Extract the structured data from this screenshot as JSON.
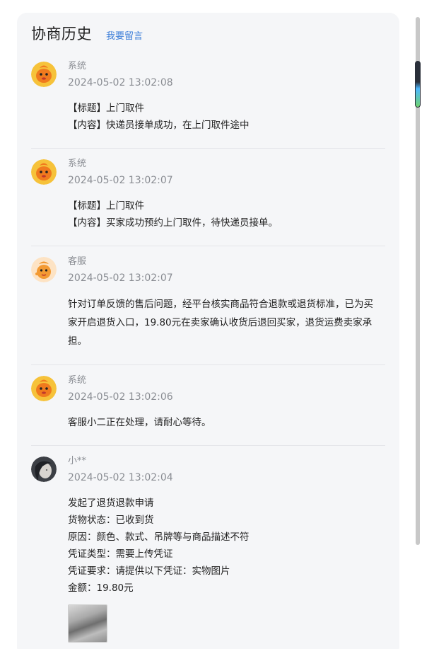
{
  "header": {
    "title": "协商历史",
    "leave_message": "我要留言"
  },
  "records": [
    {
      "author": "系统",
      "avatar": "mascot-icon",
      "time": "2024-05-02 13:02:08",
      "lines": [
        "【标题】上门取件",
        "【内容】快递员接单成功，在上门取件途中"
      ]
    },
    {
      "author": "系统",
      "avatar": "mascot-icon",
      "time": "2024-05-02 13:02:07",
      "lines": [
        "【标题】上门取件",
        "【内容】买家成功预约上门取件，待快递员接单。"
      ]
    },
    {
      "author": "客服",
      "avatar": "service-mascot-icon",
      "time": "2024-05-02 13:02:07",
      "paragraph_lines": [
        "针对订单反馈的售后问题，经平台核实商品符合退款或退货标准，已为买",
        "家开启退货入口，19.80元在卖家确认收货后退回买家，退货运费卖家承",
        "担。"
      ]
    },
    {
      "author": "系统",
      "avatar": "mascot-icon",
      "time": "2024-05-02 13:02:06",
      "lines": [
        "客服小二正在处理，请耐心等待。"
      ]
    },
    {
      "author": "小**",
      "avatar": "user-avatar",
      "time": "2024-05-02 13:02:04",
      "lines": [
        "发起了退货退款申请",
        "货物状态：已收到货",
        "原因：颜色、款式、吊牌等与商品描述不符",
        "凭证类型：需要上传凭证",
        "凭证要求：请提供以下凭证：实物图片",
        "金额：19.80元"
      ],
      "attachment": "evidence-photo"
    }
  ],
  "colors": {
    "panel_bg": "#f5f6f8",
    "link": "#3b7dd8",
    "muted": "#8a8d93",
    "mascot": "#f08a24"
  }
}
